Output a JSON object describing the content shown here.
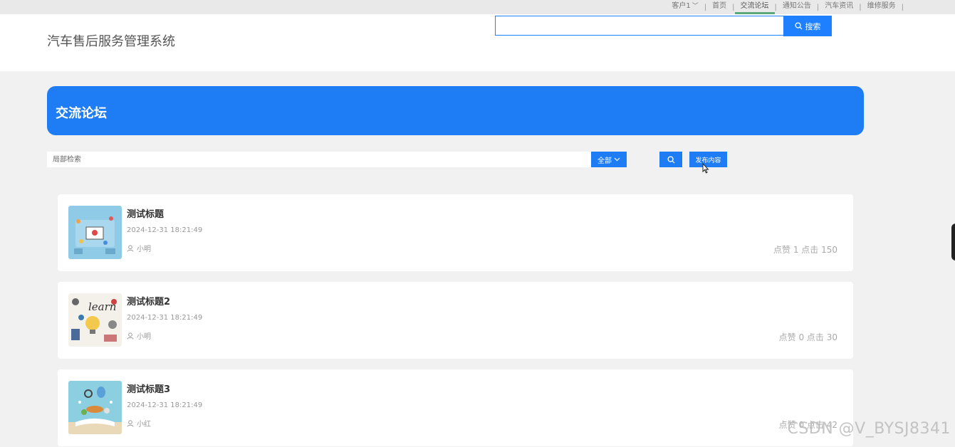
{
  "topnav": {
    "user": "客户1",
    "items": [
      "首页",
      "交流论坛",
      "通知公告",
      "汽车资讯",
      "维修服务"
    ]
  },
  "header": {
    "title": "汽车售后服务管理系统",
    "search_value": "",
    "search_button": "搜索"
  },
  "banner": {
    "title": "交流论坛"
  },
  "filter": {
    "placeholder": "局部检索",
    "select_value": "全部",
    "publish_label": "发布内容"
  },
  "posts": [
    {
      "title": "测试标题",
      "time": "2024-12-31 18:21:49",
      "author": "小明",
      "stats": "点赞 1 点击 150"
    },
    {
      "title": "测试标题2",
      "time": "2024-12-31 18:21:49",
      "author": "小明",
      "stats": "点赞 0 点击 30"
    },
    {
      "title": "测试标题3",
      "time": "2024-12-31 18:21:49",
      "author": "小红",
      "stats": "点赞 0 点击 42"
    }
  ],
  "watermark": "CSDN @V_BYSJ8341",
  "colors": {
    "primary": "#1e7cf5",
    "active_underline": "#5aa87a",
    "background": "#f1f1f1"
  },
  "icons": [
    "chevron-down-icon",
    "search-icon",
    "user-icon",
    "cursor-icon"
  ]
}
